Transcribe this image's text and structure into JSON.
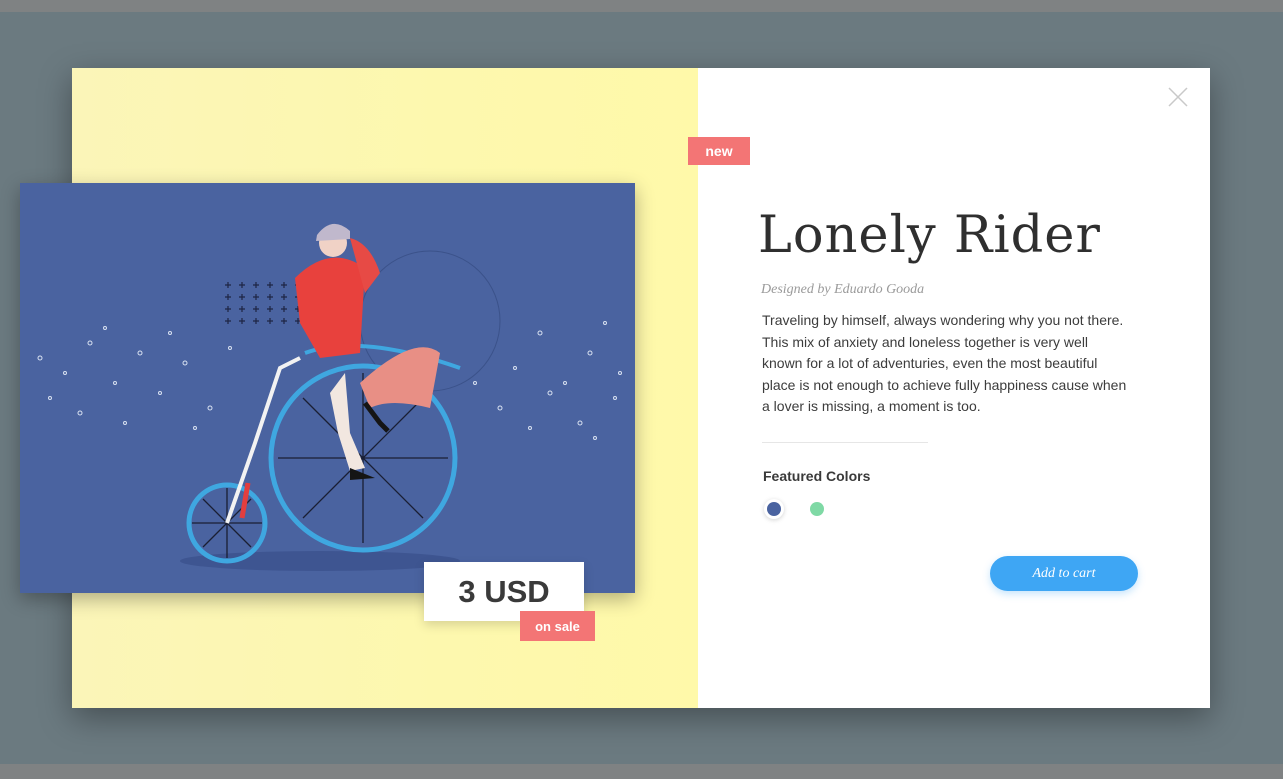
{
  "product": {
    "badge_new": "new",
    "title": "Lonely Rider",
    "designer": "Designed by Eduardo Gooda",
    "description": "Traveling by himself, always wondering why you not there. This mix of anxiety and loneless together is very well known for a lot of adventuries, even the most beautiful place is not enough to achieve fully happiness cause when a lover is missing, a moment is too.",
    "price": "3 USD",
    "sale_badge": "on sale",
    "featured_colors_label": "Featured Colors",
    "colors": [
      {
        "name": "blue-swatch",
        "hex": "#4a63a0",
        "selected": true
      },
      {
        "name": "green-swatch",
        "hex": "#7fd9a5",
        "selected": false
      }
    ],
    "add_to_cart": "Add to cart"
  },
  "icons": {
    "close": "close-icon",
    "illustration": "penny-farthing-rider-illustration"
  },
  "colors": {
    "panel_yellow": "#fdf8ae",
    "art_blue": "#4a63a0",
    "badge_red": "#f37575",
    "cta_blue": "#3ea6f4"
  }
}
